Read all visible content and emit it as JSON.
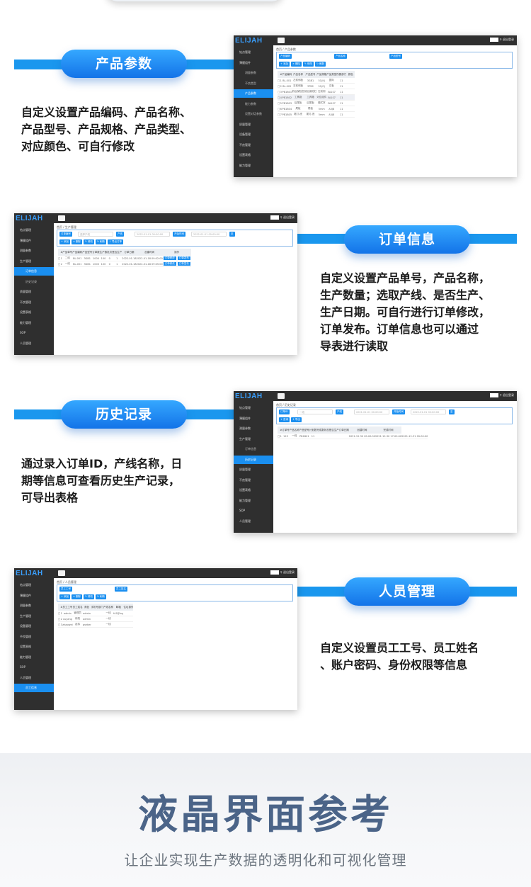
{
  "sections": [
    {
      "title": "产品参数",
      "desc": [
        "自定义设置产品编码、产品名称、",
        "产品型号、产品规格、产品类型、",
        "对应颜色、可自行修改"
      ]
    },
    {
      "title": "订单信息",
      "desc": [
        "自定义设置产品单号，产品名称，",
        "生产数量；选取产线、是否生产、",
        "生产日期。可自行进行订单修改，",
        "订单发布。订单信息也可以通过",
        "导表进行读取"
      ]
    },
    {
      "title": "历史记录",
      "desc": [
        "通过录入订单ID，产线名称，日",
        "期等信息可查看历史生产记录，",
        "可导出表格"
      ]
    },
    {
      "title": "人员管理",
      "desc": [
        "自定义设置员工工号、员工姓名",
        "、账户密码、身份权限等信息"
      ]
    }
  ],
  "app": {
    "logo": "ELIJAH",
    "logout": "退出登录"
  },
  "shot1": {
    "nav": [
      "钻点管理",
      "薄膜组件",
      "测量参数",
      "不良类型",
      "产品参数",
      "能力参数",
      "设置对话参数",
      "质量管理",
      "设备管理",
      "不良管理",
      "设置表格",
      "能力管理"
    ],
    "active": 4,
    "crumb": "首页 / 产品参数",
    "chips": [
      "产品编码",
      "产品名称",
      "产品型号"
    ],
    "buttons": [
      "+ 添加",
      "× 删除",
      "✎ 修改",
      "↻ 刷新"
    ],
    "headers": [
      "",
      "#",
      "产品编码",
      "产品名称",
      "产品型号",
      "产品规格",
      "产品类型",
      "所属部门",
      "颜色"
    ],
    "rows": [
      [
        "1",
        "BL-001",
        "左前侧板",
        "3GB1",
        "51(K)",
        "国际",
        "11"
      ],
      [
        "2",
        "BL-002",
        "右前侧板",
        "3TB2",
        "51(E)",
        "左板",
        "11"
      ],
      [
        "3",
        "PB1B01",
        "前后保险杠",
        "前后保险杠",
        "左前侧",
        "5A1S7",
        "11"
      ],
      [
        "4",
        "PB1B02",
        "工具箱",
        "工具箱",
        "对应组件",
        "5A1S7",
        "11"
      ],
      [
        "5",
        "PB1B03",
        "后尾板",
        "后尾板",
        "厢式货",
        "5A1S7",
        "11"
      ],
      [
        "6",
        "PB1B04",
        "尾板",
        "尾板",
        "5mm",
        "A5J8",
        "11"
      ],
      [
        "7",
        "PB1B05",
        "尾灯-底",
        "尾灯-底",
        "5mm",
        "A5J8",
        "11"
      ]
    ],
    "colors": [
      "#000000",
      "#19e619",
      "#e53b14",
      "#e53b14",
      "#e53b14",
      "#e53b14",
      "#0c28ee"
    ]
  },
  "shot2": {
    "nav": [
      "钻点管理",
      "薄膜组件",
      "测量参数",
      "生产管理",
      "订单信息",
      "历史记录",
      "质量管理",
      "不良管理",
      "设置表格",
      "能力管理",
      "SOP",
      "人员管理"
    ],
    "active": 4,
    "crumb": "首页 / 生产管理",
    "chips": [
      "订单编号",
      "产线",
      "开始时间",
      "至"
    ],
    "inputs": [
      "选择产线",
      "2022-01-01 00:00:00",
      "2022-01-01 00:00:00"
    ],
    "buttons": [
      "+ 添加",
      "× 删除",
      "✎ 修改",
      "↻ 刷新",
      "⇩ 导出订单"
    ],
    "headers": [
      "",
      "#",
      "产品单号",
      "产品编码",
      "产品型号",
      "订单数",
      "生产数",
      "批次",
      "是否生产",
      "订单日期",
      "创建时间",
      "操作"
    ],
    "rows": [
      [
        "1",
        "二线",
        "BL-001",
        "3GB1",
        "1000",
        "100",
        "0",
        "1",
        "2022-01-18",
        "2022-01-18 09:02:00"
      ],
      [
        "2",
        "一线",
        "BL-001",
        "3GB1",
        "1000",
        "100",
        "0",
        "1",
        "2022-01-18",
        "2022-01-18 09:05:00"
      ]
    ],
    "actions": [
      "订单修改",
      "订单发布"
    ]
  },
  "shot3": {
    "nav": [
      "钻点管理",
      "薄膜组件",
      "测量参数",
      "生产管理",
      "订单信息",
      "历史记录",
      "质量管理",
      "不良管理",
      "设置表格",
      "能力管理",
      "SOP",
      "人员管理"
    ],
    "active": 5,
    "crumb": "首页 / 历史记录",
    "chips": [
      "订单ID",
      "产线",
      "开始时间",
      "至"
    ],
    "inputs": [
      "一线",
      "2021-01-01 00:00:00",
      "2022-01-01 00:00:00"
    ],
    "buttons": [
      "+ 查询",
      "⇩ 导出"
    ],
    "headers": [
      "",
      "#",
      "订单号",
      "产品名称",
      "产品型号",
      "计划数",
      "完成数",
      "状态",
      "是否生产",
      "订单日期",
      "创建时间",
      "完成时间"
    ],
    "rows": [
      [
        "1",
        "123",
        "一线",
        "PB1B01",
        "11",
        "",
        "",
        "",
        "",
        "2021-12-30 09:00:00",
        "2021-12-30 17:00:00",
        "2021-12-31 09:00:00"
      ]
    ]
  },
  "shot4": {
    "nav": [
      "钻点管理",
      "薄膜组件",
      "测量参数",
      "生产管理",
      "设备管理",
      "不良管理",
      "设置表格",
      "能力管理",
      "SOP",
      "人员管理",
      "员工信息"
    ],
    "active": 10,
    "crumb": "首页 / 人员管理",
    "chips": [
      "员工工号",
      "员工姓名"
    ],
    "buttons": [
      "+ 添加",
      "× 删除",
      "✎ 修改",
      "↻ 刷新"
    ],
    "headers": [
      "",
      "#",
      "员工工号",
      "员工姓名",
      "角色",
      "手机号",
      "部门",
      "产线名称",
      "邮箱",
      "住址",
      "操作"
    ],
    "rows": [
      [
        "1",
        "admin",
        "管理员",
        "admin",
        "",
        "",
        "一线",
        "fx2@ing"
      ],
      [
        "2",
        "xuyang",
        "徐阳",
        "admin",
        "",
        "",
        "一线",
        ""
      ],
      [
        "3",
        "zhaowei",
        "赵伟",
        "worker",
        "",
        "",
        "一线",
        ""
      ]
    ]
  },
  "footer": {
    "title": "液晶界面参考",
    "subtitle": "让企业实现生产数据的透明化和可视化管理"
  }
}
